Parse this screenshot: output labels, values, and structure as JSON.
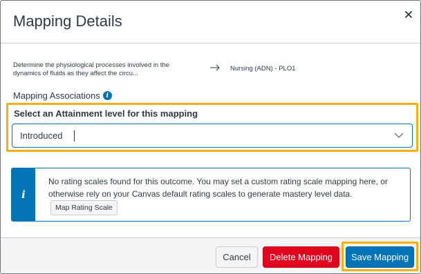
{
  "modal": {
    "title": "Mapping Details",
    "close_icon": "close-icon"
  },
  "outcome": {
    "source_text": "Determine the physiological processes involved in the dynamics of fluids as they affect the circu...",
    "arrow_icon": "arrow-right-icon",
    "target_text": "Nursing (ADN) - PLO1"
  },
  "associations": {
    "label": "Mapping Associations",
    "info_icon": "info-icon"
  },
  "attainment": {
    "label": "Select an Attainment level for this mapping",
    "selected_value": "Introduced",
    "chevron_icon": "chevron-down-icon"
  },
  "alert": {
    "icon": "info-icon",
    "text": "No rating scales found for this outcome. You may set a custom rating scale mapping here, or otherwise rely on your Canvas default rating scales to generate mastery level data.",
    "button_label": "Map Rating Scale"
  },
  "footer": {
    "cancel_label": "Cancel",
    "delete_label": "Delete Mapping",
    "save_label": "Save Mapping"
  },
  "colors": {
    "accent_blue": "#0374b5",
    "highlight_yellow": "#f6b00e",
    "danger_red": "#e0061f"
  }
}
